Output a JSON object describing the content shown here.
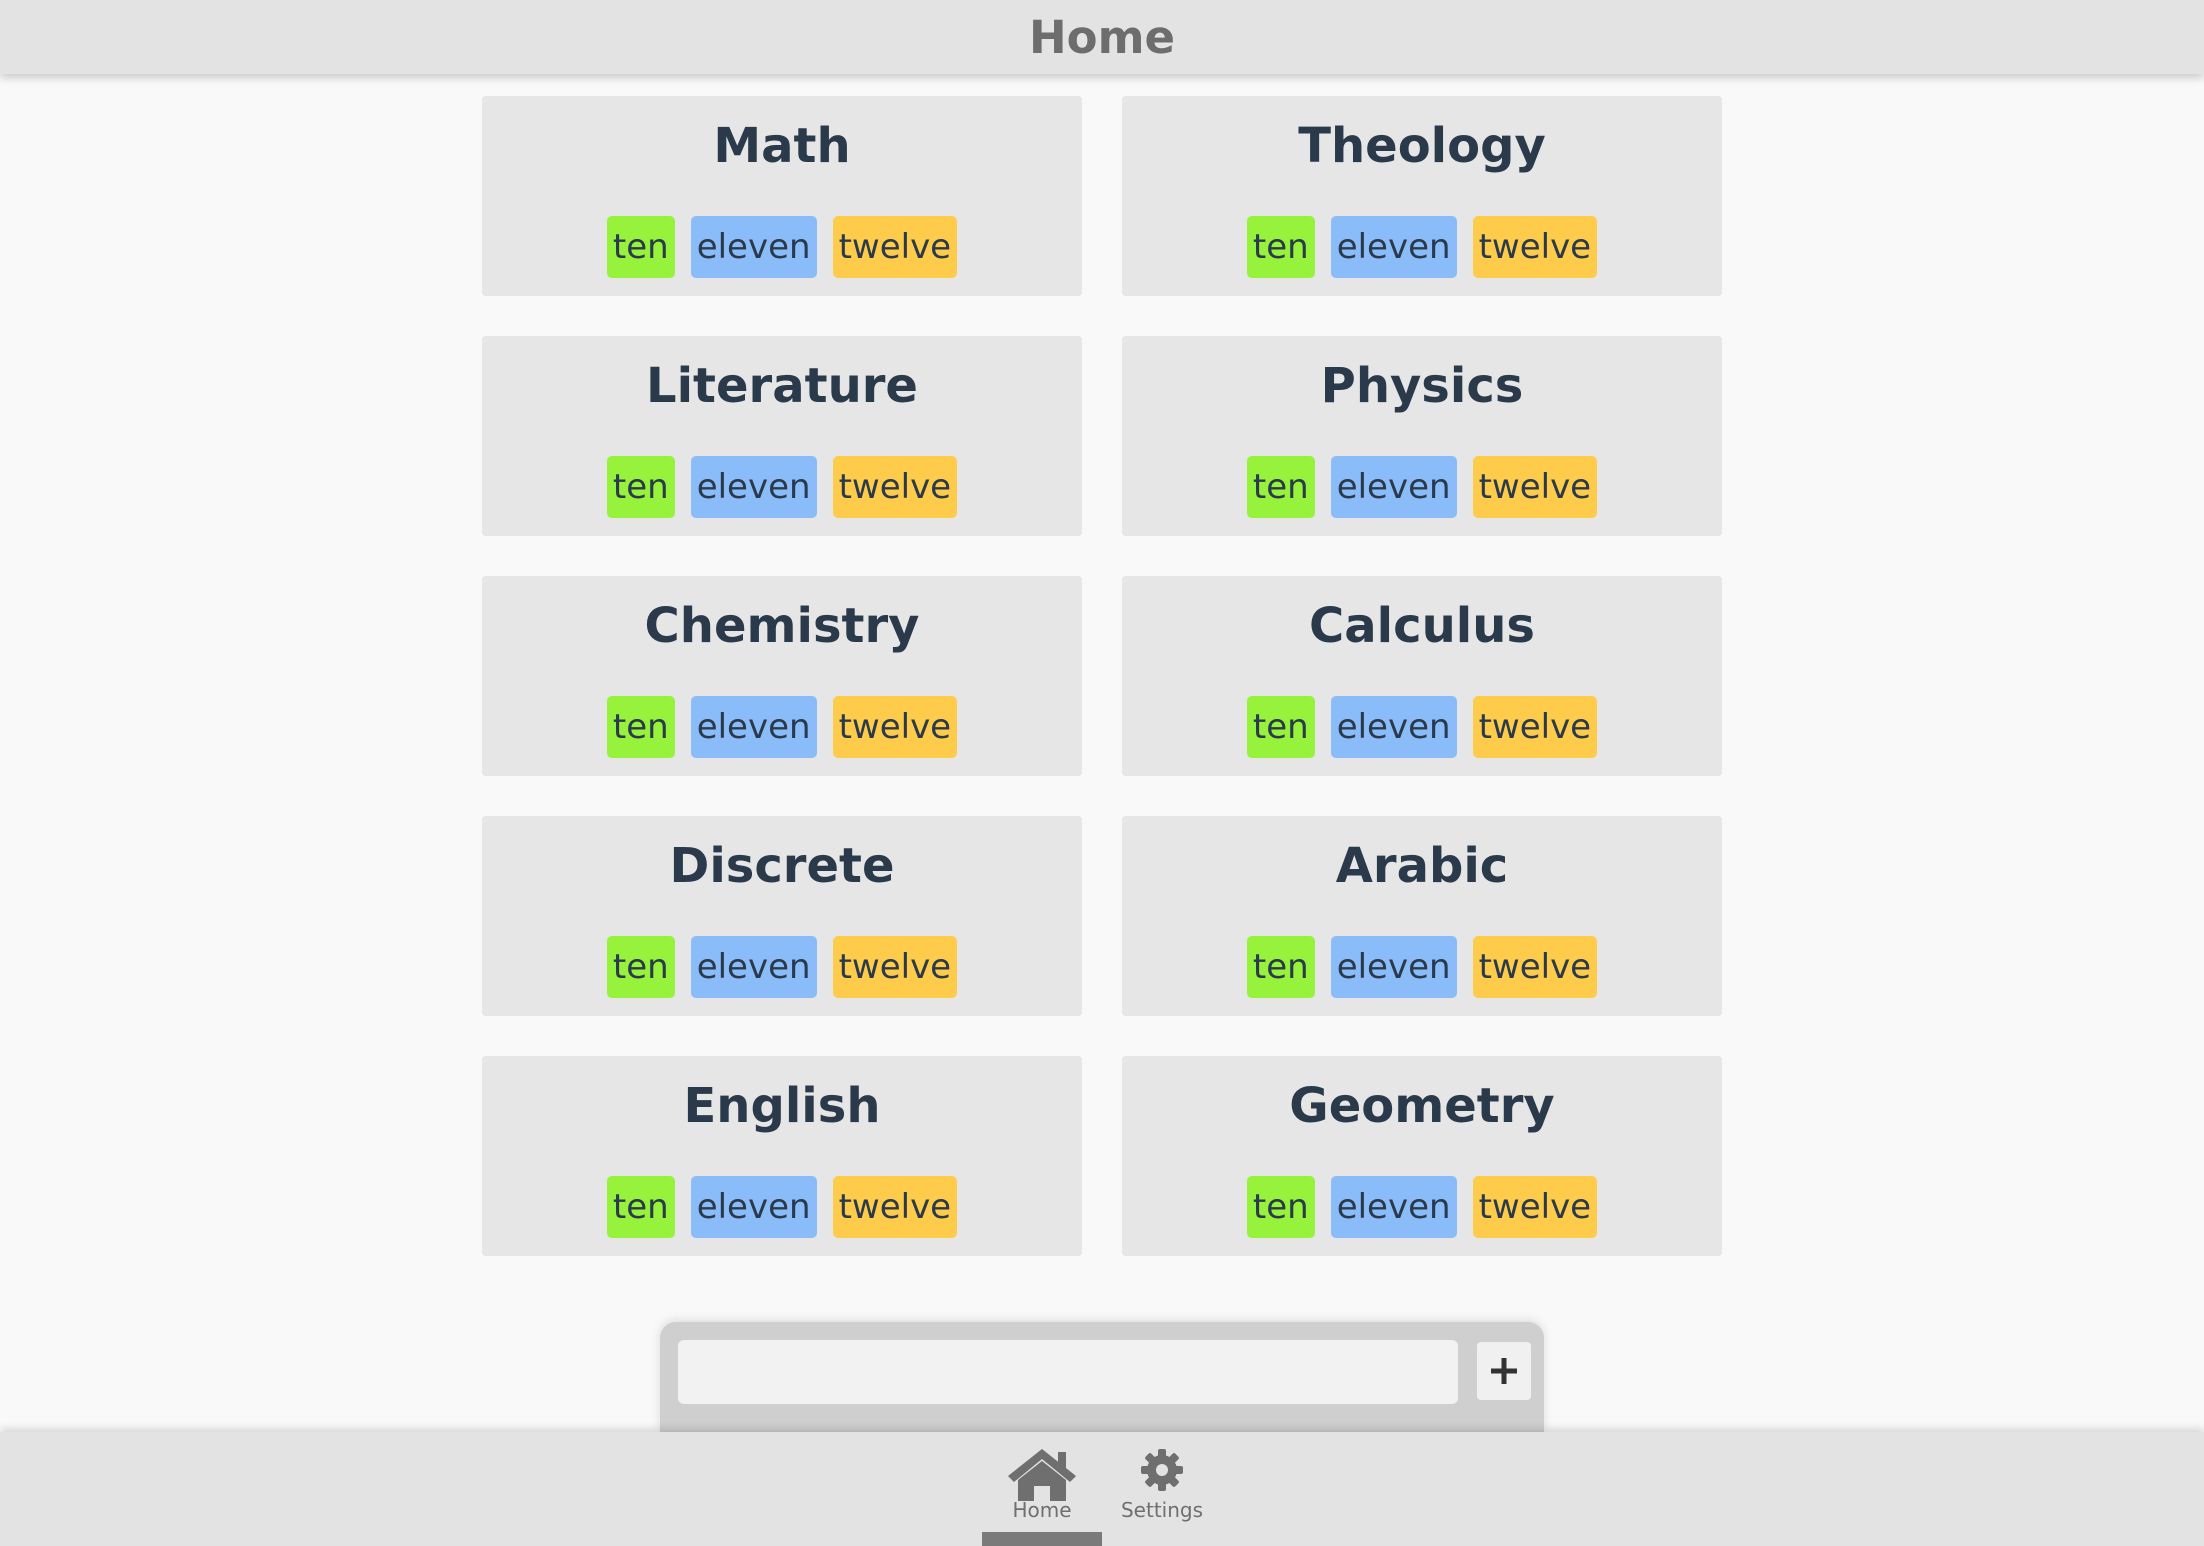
{
  "header": {
    "title": "Home"
  },
  "subjects": [
    {
      "name": "Math",
      "levels": [
        "ten",
        "eleven",
        "twelve"
      ]
    },
    {
      "name": "Theology",
      "levels": [
        "ten",
        "eleven",
        "twelve"
      ]
    },
    {
      "name": "Literature",
      "levels": [
        "ten",
        "eleven",
        "twelve"
      ]
    },
    {
      "name": "Physics",
      "levels": [
        "ten",
        "eleven",
        "twelve"
      ]
    },
    {
      "name": "Chemistry",
      "levels": [
        "ten",
        "eleven",
        "twelve"
      ]
    },
    {
      "name": "Calculus",
      "levels": [
        "ten",
        "eleven",
        "twelve"
      ]
    },
    {
      "name": "Discrete",
      "levels": [
        "ten",
        "eleven",
        "twelve"
      ]
    },
    {
      "name": "Arabic",
      "levels": [
        "ten",
        "eleven",
        "twelve"
      ]
    },
    {
      "name": "English",
      "levels": [
        "ten",
        "eleven",
        "twelve"
      ]
    },
    {
      "name": "Geometry",
      "levels": [
        "ten",
        "eleven",
        "twelve"
      ]
    }
  ],
  "add_subject": {
    "input_value": "",
    "placeholder": "",
    "button_icon": "plus-icon"
  },
  "bottom_nav": {
    "active": "home",
    "items": [
      {
        "id": "home",
        "label": "Home",
        "icon": "home-icon"
      },
      {
        "id": "settings",
        "label": "Settings",
        "icon": "gear-icon"
      }
    ]
  },
  "colors": {
    "ten": "#96f23a",
    "eleven": "#8bbcfa",
    "twelve": "#ffcb4a",
    "text": "#2b3a4a"
  }
}
